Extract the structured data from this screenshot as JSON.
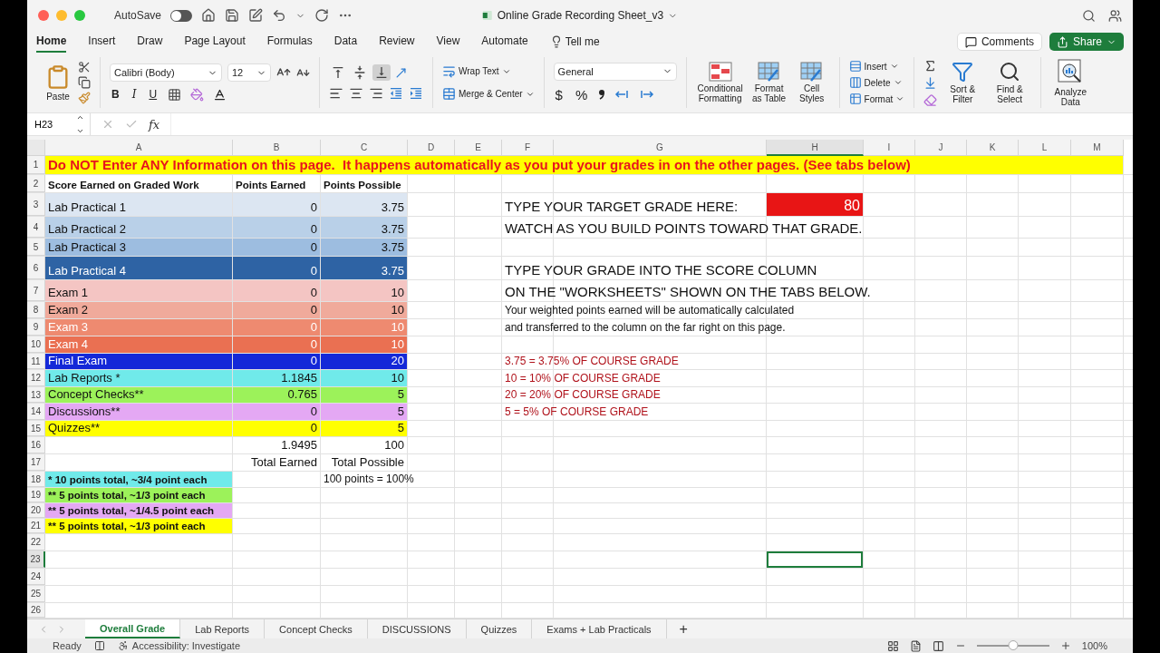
{
  "window": {
    "title": "Online Grade Recording Sheet_v3",
    "autosave_label": "AutoSave",
    "autosave_on": false
  },
  "menu_tabs": [
    {
      "label": "Home",
      "selected": true
    },
    {
      "label": "Insert",
      "selected": false
    },
    {
      "label": "Draw",
      "selected": false
    },
    {
      "label": "Page Layout",
      "selected": false
    },
    {
      "label": "Formulas",
      "selected": false
    },
    {
      "label": "Data",
      "selected": false
    },
    {
      "label": "Review",
      "selected": false
    },
    {
      "label": "View",
      "selected": false
    },
    {
      "label": "Automate",
      "selected": false
    }
  ],
  "tell_me": "Tell me",
  "actions": {
    "comments": "Comments",
    "share": "Share"
  },
  "ribbon": {
    "paste": "Paste",
    "font": "Calibri (Body)",
    "size": "12",
    "bold": "B",
    "italic": "I",
    "underline": "U",
    "wrap": "Wrap Text",
    "merge": "Merge & Center",
    "number_format": "General",
    "dollar": "$",
    "percent": "%",
    "vertical_align": [
      {
        "kind": "top",
        "selected": false
      },
      {
        "kind": "middle",
        "selected": false
      },
      {
        "kind": "bottom",
        "selected": true
      }
    ],
    "conditional": "Conditional Formatting",
    "format_table": "Format as Table",
    "cell_styles": "Cell Styles",
    "insert": "Insert",
    "delete": "Delete",
    "format": "Format",
    "sort": "Sort & Filter",
    "find": "Find & Select",
    "analyze": "Analyze Data"
  },
  "name_box": "H23",
  "function_label": "fx",
  "columns": [
    "A",
    "B",
    "C",
    "D",
    "E",
    "F",
    "G",
    "H",
    "I",
    "J",
    "K",
    "L",
    "M"
  ],
  "rows": [
    {
      "number": "1",
      "cells": {
        "A": {
          "kind": "warning",
          "text": "Do NOT Enter ANY Information on this page.  It happens automatically as you put your grades in on the other pages. (See tabs below)",
          "color": "#ffff00",
          "selected": false
        }
      }
    },
    {
      "number": "2",
      "cells": {
        "A": {
          "kind": "header",
          "text": "Score Earned on Graded Work",
          "selected": false
        },
        "B": {
          "kind": "header",
          "text": "Points Earned",
          "selected": false
        },
        "C": {
          "kind": "header",
          "text": "Points Possible",
          "selected": false
        }
      }
    },
    {
      "number": "3",
      "cells": {
        "A": {
          "kind": "label",
          "text": "Lab Practical 1",
          "color": "#dce6f2",
          "selected": false
        },
        "B": {
          "kind": "number",
          "text": "0",
          "color": "#dce6f2",
          "selected": false
        },
        "C": {
          "kind": "number",
          "text": "3.75",
          "color": "#dce6f2",
          "selected": false
        },
        "F": {
          "kind": "big",
          "text": "TYPE YOUR TARGET GRADE HERE:",
          "selected": false
        },
        "H": {
          "kind": "target",
          "text": "80",
          "color": "#e81515",
          "selected": false
        }
      }
    },
    {
      "number": "4",
      "cells": {
        "A": {
          "kind": "label",
          "text": "Lab Practical 2",
          "color": "#b9d0e8",
          "selected": false
        },
        "B": {
          "kind": "number",
          "text": "0",
          "color": "#b9d0e8",
          "selected": false
        },
        "C": {
          "kind": "number",
          "text": "3.75",
          "color": "#b9d0e8",
          "selected": false
        },
        "F": {
          "kind": "big",
          "text": "WATCH AS YOU BUILD POINTS TOWARD THAT GRADE.",
          "selected": false
        }
      }
    },
    {
      "number": "5",
      "cells": {
        "A": {
          "kind": "label",
          "text": "Lab Practical 3",
          "color": "#9dbde0",
          "selected": false
        },
        "B": {
          "kind": "number",
          "text": "0",
          "color": "#9dbde0",
          "selected": false
        },
        "C": {
          "kind": "number",
          "text": "3.75",
          "color": "#9dbde0",
          "selected": false
        }
      }
    },
    {
      "number": "6",
      "cells": {
        "A": {
          "kind": "label",
          "text": "Lab Practical 4",
          "color": "#2e63a4",
          "selected": false
        },
        "B": {
          "kind": "number",
          "text": "0",
          "color": "#2e63a4",
          "selected": false
        },
        "C": {
          "kind": "number",
          "text": "3.75",
          "color": "#2e63a4",
          "selected": false
        },
        "F": {
          "kind": "big",
          "text": "TYPE YOUR GRADE INTO THE SCORE COLUMN",
          "selected": false
        }
      }
    },
    {
      "number": "7",
      "cells": {
        "A": {
          "kind": "label",
          "text": "Exam 1",
          "color": "#f4c5c3",
          "selected": false
        },
        "B": {
          "kind": "number",
          "text": "0",
          "color": "#f4c5c3",
          "selected": false
        },
        "C": {
          "kind": "number",
          "text": "10",
          "color": "#f4c5c3",
          "selected": false
        },
        "F": {
          "kind": "big",
          "text": "ON THE \"WORKSHEETS\" SHOWN ON THE TABS BELOW.",
          "selected": false
        }
      }
    },
    {
      "number": "8",
      "cells": {
        "A": {
          "kind": "label",
          "text": "Exam 2",
          "color": "#f0aa9b",
          "selected": false
        },
        "B": {
          "kind": "number",
          "text": "0",
          "color": "#f0aa9b",
          "selected": false
        },
        "C": {
          "kind": "number",
          "text": "10",
          "color": "#f0aa9b",
          "selected": false
        },
        "F": {
          "kind": "plain",
          "text": "Your weighted points earned will be automatically calculated",
          "selected": false
        }
      }
    },
    {
      "number": "9",
      "cells": {
        "A": {
          "kind": "label",
          "text": "Exam 3",
          "color": "#ee8a70",
          "selected": false
        },
        "B": {
          "kind": "number",
          "text": "0",
          "color": "#ee8a70",
          "selected": false
        },
        "C": {
          "kind": "number",
          "text": "10",
          "color": "#ee8a70",
          "selected": false
        },
        "F": {
          "kind": "plain",
          "text": "and transferred to the column on the far right on this page.",
          "selected": false
        }
      }
    },
    {
      "number": "10",
      "cells": {
        "A": {
          "kind": "label",
          "text": "Exam 4",
          "color": "#ea7052",
          "selected": false
        },
        "B": {
          "kind": "number",
          "text": "0",
          "color": "#ea7052",
          "selected": false
        },
        "C": {
          "kind": "number",
          "text": "10",
          "color": "#ea7052",
          "selected": false
        }
      }
    },
    {
      "number": "11",
      "cells": {
        "A": {
          "kind": "label",
          "text": "Final Exam",
          "color": "#1428d8",
          "selected": false
        },
        "B": {
          "kind": "number",
          "text": "0",
          "color": "#1428d8",
          "selected": false
        },
        "C": {
          "kind": "number",
          "text": "20",
          "color": "#1428d8",
          "selected": false
        },
        "F": {
          "kind": "note",
          "text": "3.75 = 3.75% OF COURSE GRADE",
          "selected": false
        }
      }
    },
    {
      "number": "12",
      "cells": {
        "A": {
          "kind": "label",
          "text": "Lab Reports *",
          "color": "#70eaea",
          "selected": false
        },
        "B": {
          "kind": "number",
          "text": "1.1845",
          "color": "#70eaea",
          "selected": false
        },
        "C": {
          "kind": "number",
          "text": "10",
          "color": "#70eaea",
          "selected": false
        },
        "F": {
          "kind": "note",
          "text": "10 = 10% OF COURSE GRADE",
          "selected": false
        }
      }
    },
    {
      "number": "13",
      "cells": {
        "A": {
          "kind": "label",
          "text": "Concept Checks**",
          "color": "#9cf25a",
          "selected": false
        },
        "B": {
          "kind": "number",
          "text": "0.765",
          "color": "#9cf25a",
          "selected": false
        },
        "C": {
          "kind": "number",
          "text": "5",
          "color": "#9cf25a",
          "selected": false
        },
        "F": {
          "kind": "note",
          "text": "20 = 20% OF COURSE GRADE",
          "selected": false
        }
      }
    },
    {
      "number": "14",
      "cells": {
        "A": {
          "kind": "label",
          "text": "Discussions**",
          "color": "#e4a8f4",
          "selected": false
        },
        "B": {
          "kind": "number",
          "text": "0",
          "color": "#e4a8f4",
          "selected": false
        },
        "C": {
          "kind": "number",
          "text": "5",
          "color": "#e4a8f4",
          "selected": false
        },
        "F": {
          "kind": "note",
          "text": "5 = 5% OF COURSE GRADE",
          "selected": false
        }
      }
    },
    {
      "number": "15",
      "cells": {
        "A": {
          "kind": "label",
          "text": "Quizzes**",
          "color": "#ffff00",
          "selected": false
        },
        "B": {
          "kind": "number",
          "text": "0",
          "color": "#ffff00",
          "selected": false
        },
        "C": {
          "kind": "number",
          "text": "5",
          "color": "#ffff00",
          "selected": false
        }
      }
    },
    {
      "number": "16",
      "cells": {
        "B": {
          "kind": "number",
          "text": "1.9495",
          "selected": false
        },
        "C": {
          "kind": "number",
          "text": "100",
          "selected": false
        }
      }
    },
    {
      "number": "17",
      "cells": {
        "B": {
          "kind": "caption",
          "text": "Total Earned",
          "selected": false
        },
        "C": {
          "kind": "caption",
          "text": "Total Possible",
          "selected": false
        }
      }
    },
    {
      "number": "18",
      "cells": {
        "A": {
          "kind": "key",
          "text": "* 10 points total, ~3/4 point each",
          "color": "#70eaea",
          "selected": false
        },
        "C": {
          "kind": "plain",
          "text": "100 points = 100%",
          "selected": false
        }
      }
    },
    {
      "number": "19",
      "cells": {
        "A": {
          "kind": "key",
          "text": "** 5 points total, ~1/3 point each",
          "color": "#9cf25a",
          "selected": false
        }
      }
    },
    {
      "number": "20",
      "cells": {
        "A": {
          "kind": "key",
          "text": "** 5 points total, ~1/4.5 point each",
          "color": "#e4a8f4",
          "selected": false
        }
      }
    },
    {
      "number": "21",
      "cells": {
        "A": {
          "kind": "key",
          "text": "** 5 points total, ~1/3 point each",
          "color": "#ffff00",
          "selected": false
        }
      }
    },
    {
      "number": "22"
    },
    {
      "number": "23",
      "cells": {
        "H": {
          "kind": "empty",
          "selected": true
        }
      }
    },
    {
      "number": "24"
    },
    {
      "number": "25"
    },
    {
      "number": "26"
    }
  ],
  "sheet_tabs": [
    {
      "label": "Overall Grade",
      "selected": true
    },
    {
      "label": "Lab Reports",
      "selected": false
    },
    {
      "label": "Concept Checks",
      "selected": false
    },
    {
      "label": "DISCUSSIONS",
      "selected": false
    },
    {
      "label": "Quizzes",
      "selected": false
    },
    {
      "label": "Exams + Lab Practicals",
      "selected": false
    }
  ],
  "add_sheet": "+",
  "status": {
    "ready": "Ready",
    "accessibility": "Accessibility: Investigate",
    "zoom": "100%",
    "zoom_slider": {
      "level": 0.5
    }
  }
}
